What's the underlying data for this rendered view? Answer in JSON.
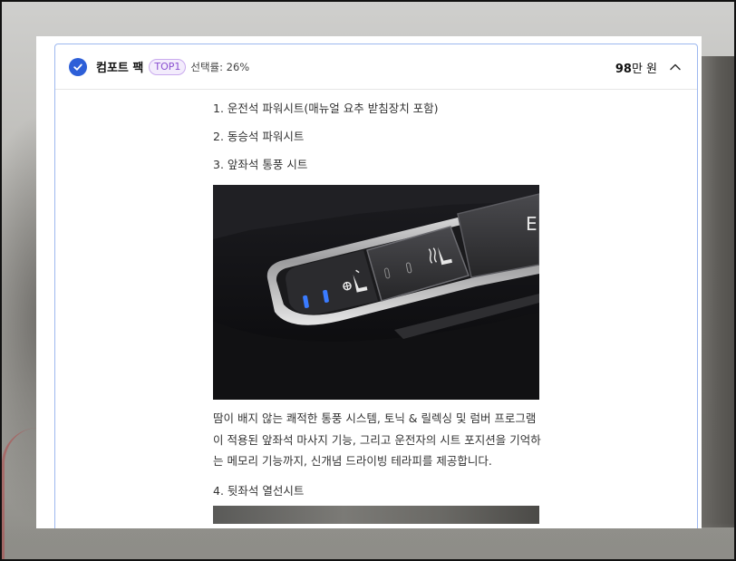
{
  "option": {
    "title": "컴포트 팩",
    "badge": "TOP1",
    "select_rate": "선택률: 26%",
    "price_amount": "98",
    "price_unit": "만 원"
  },
  "items": [
    {
      "label": "1. 운전석 파워시트(매뉴얼 요추 받침장치 포함)"
    },
    {
      "label": "2. 동승석 파워시트"
    },
    {
      "label": "3. 앞좌석 통풍 시트"
    }
  ],
  "description": "땀이 배지 않는 쾌적한 통풍 시스템, 토닉 & 릴렉싱 및 럼버 프로그램이 적용된 앞좌석 마사지 기능, 그리고 운전자의 시트 포지션을 기억하는 메모리 기능까지, 신개념 드라이빙 테라피를 제공합니다.",
  "item4": {
    "label": "4. 뒷좌석 열선시트"
  },
  "photo": {
    "panel_text": "E"
  },
  "colors": {
    "accent": "#2d5fd8",
    "badge_text": "#8a4fd0",
    "card_border": "#9db8ef",
    "led_blue": "#3a7bff"
  },
  "icons": {
    "check": "check-icon",
    "collapse": "chevron-up-icon",
    "ventilated_seat": "ventilated-seat-icon",
    "heated_seat": "heated-seat-icon"
  }
}
